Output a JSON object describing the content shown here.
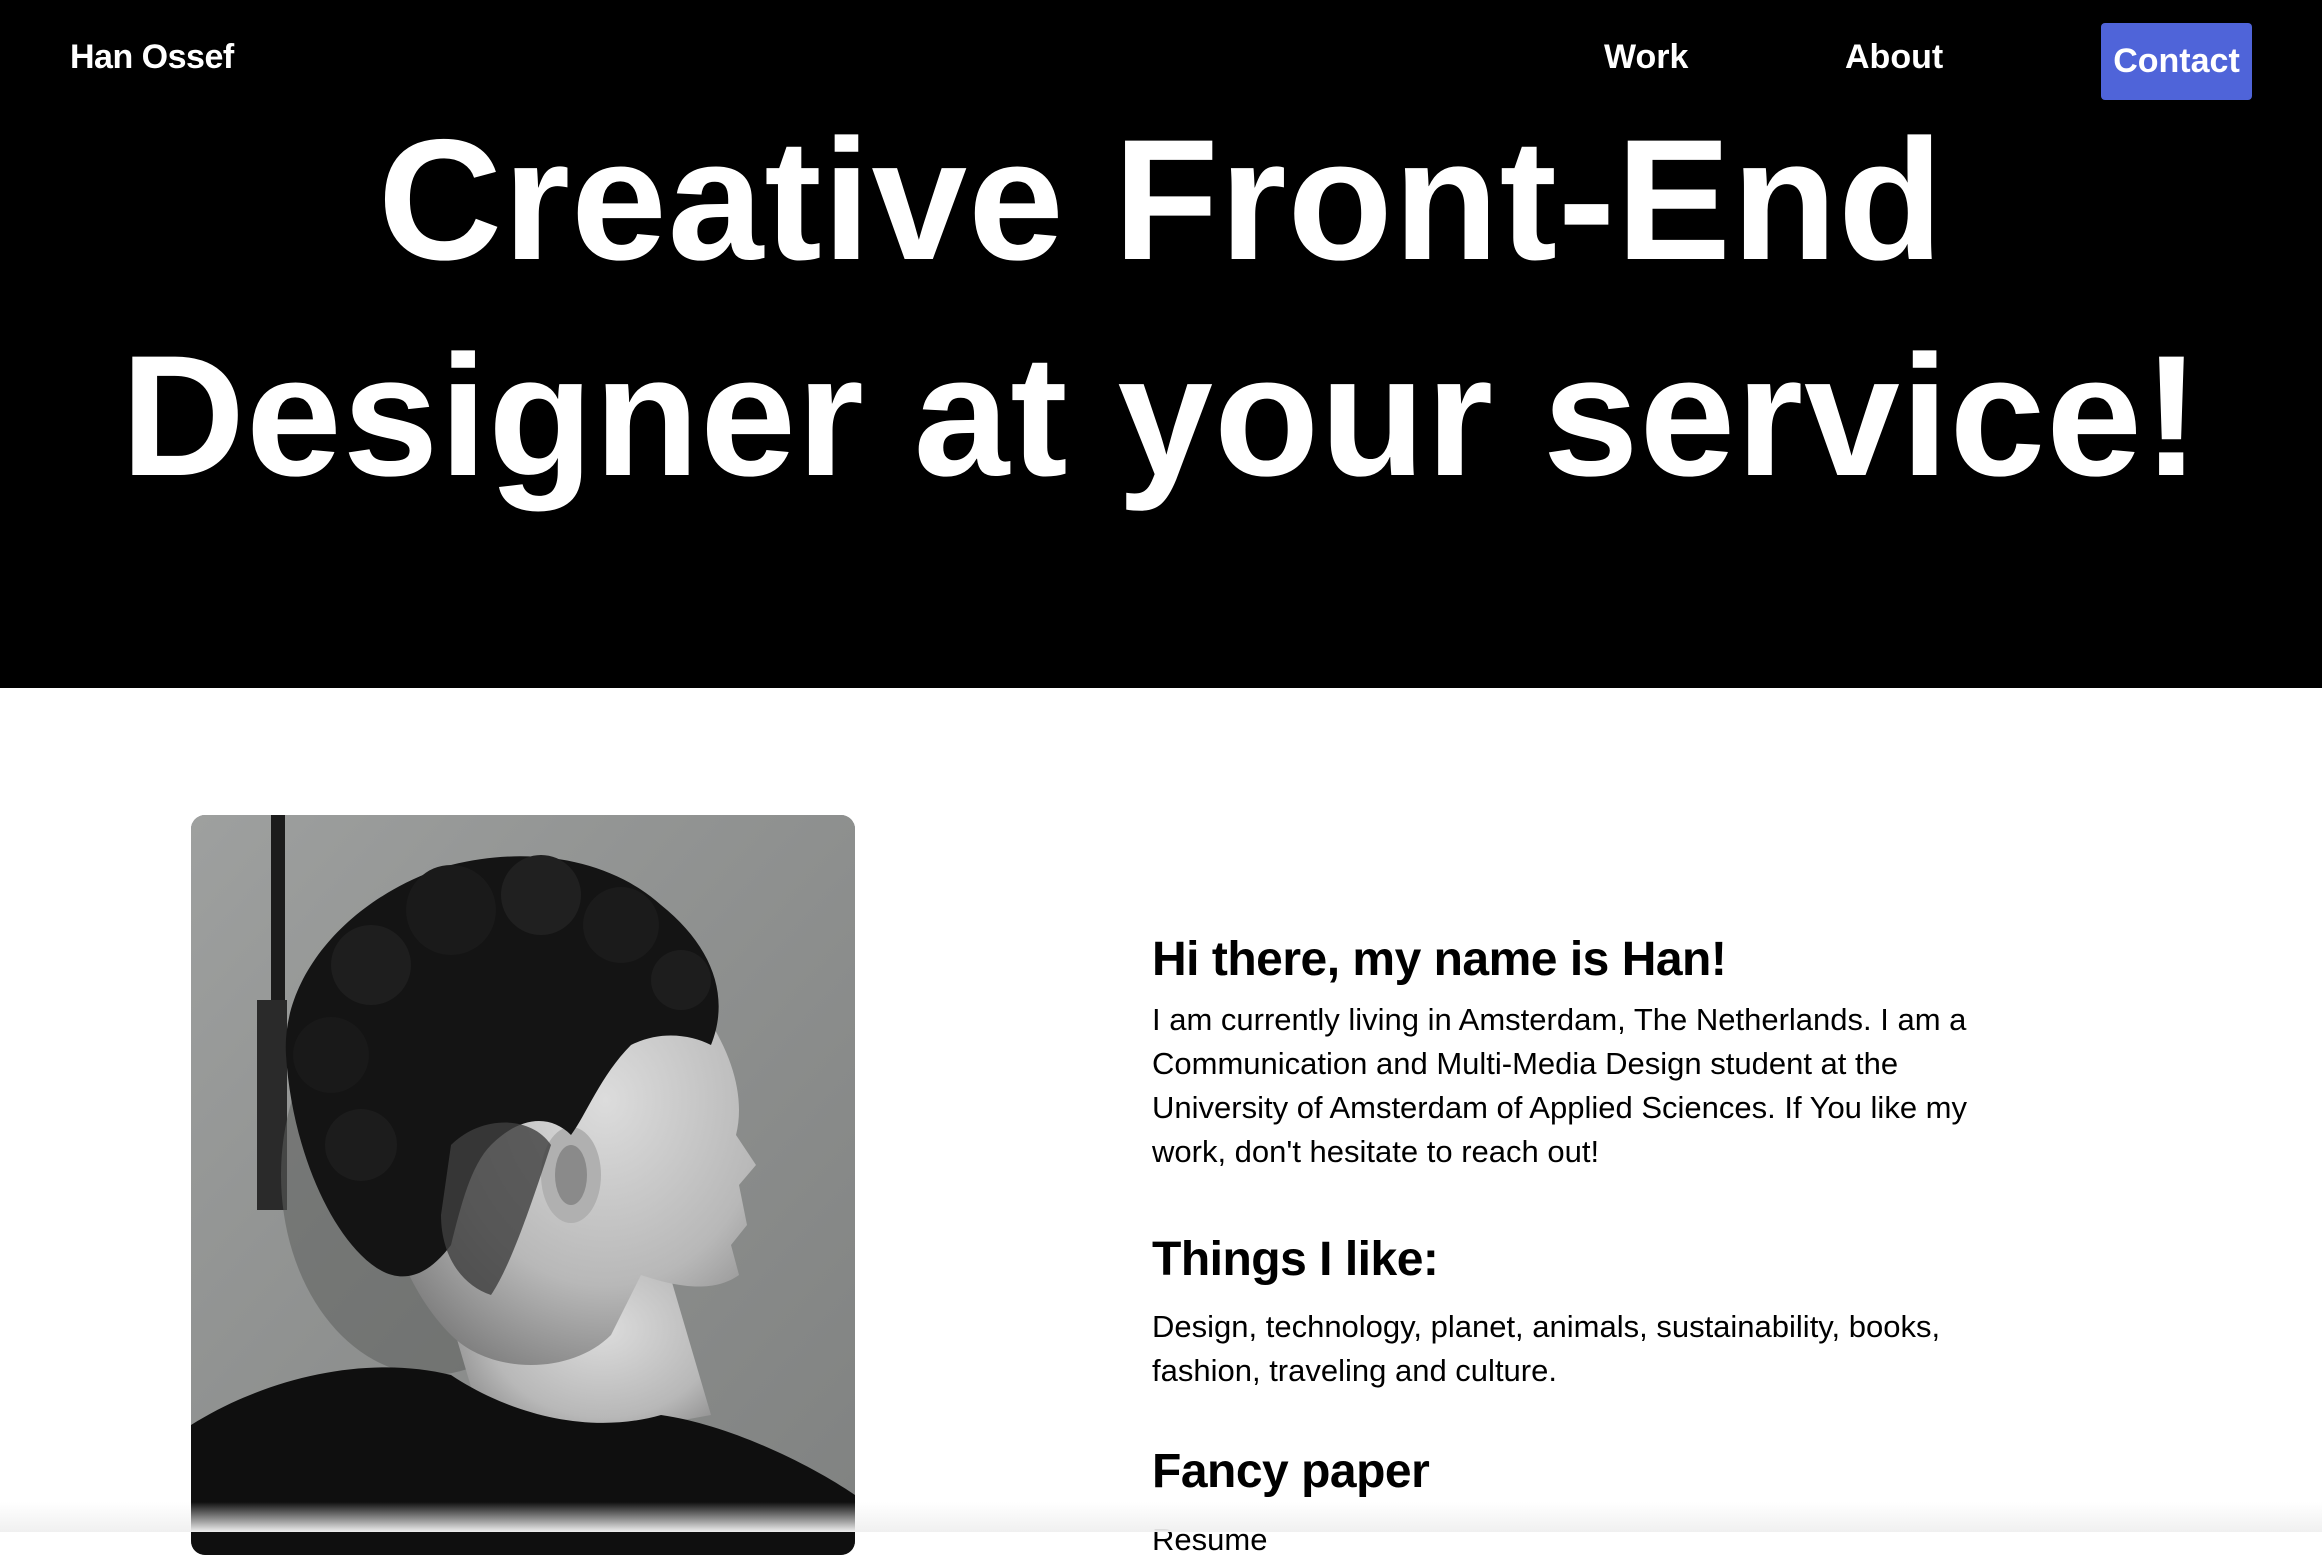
{
  "header": {
    "brand": "Han Ossef",
    "nav": {
      "work": "Work",
      "about": "About",
      "contact": "Contact"
    }
  },
  "hero": {
    "line1": "Creative Front-End",
    "line2": "Designer at your service!"
  },
  "about": {
    "intro_heading": "Hi there, my name is Han!",
    "intro_text": "I am currently living in Amsterdam, The Netherlands. I am a Communication and Multi-Media Design student at the University of Amsterdam of Applied Sciences. If You like my work, don't hesitate to reach out!",
    "likes_heading": "Things I like:",
    "likes_text": "Design, technology, planet, animals, sustainability, books, fashion, traveling and culture.",
    "paper_heading": "Fancy paper",
    "paper_text": "Resume"
  },
  "colors": {
    "hero_background": "#000000",
    "contact_button": "#4f64d9",
    "text": "#000000"
  }
}
